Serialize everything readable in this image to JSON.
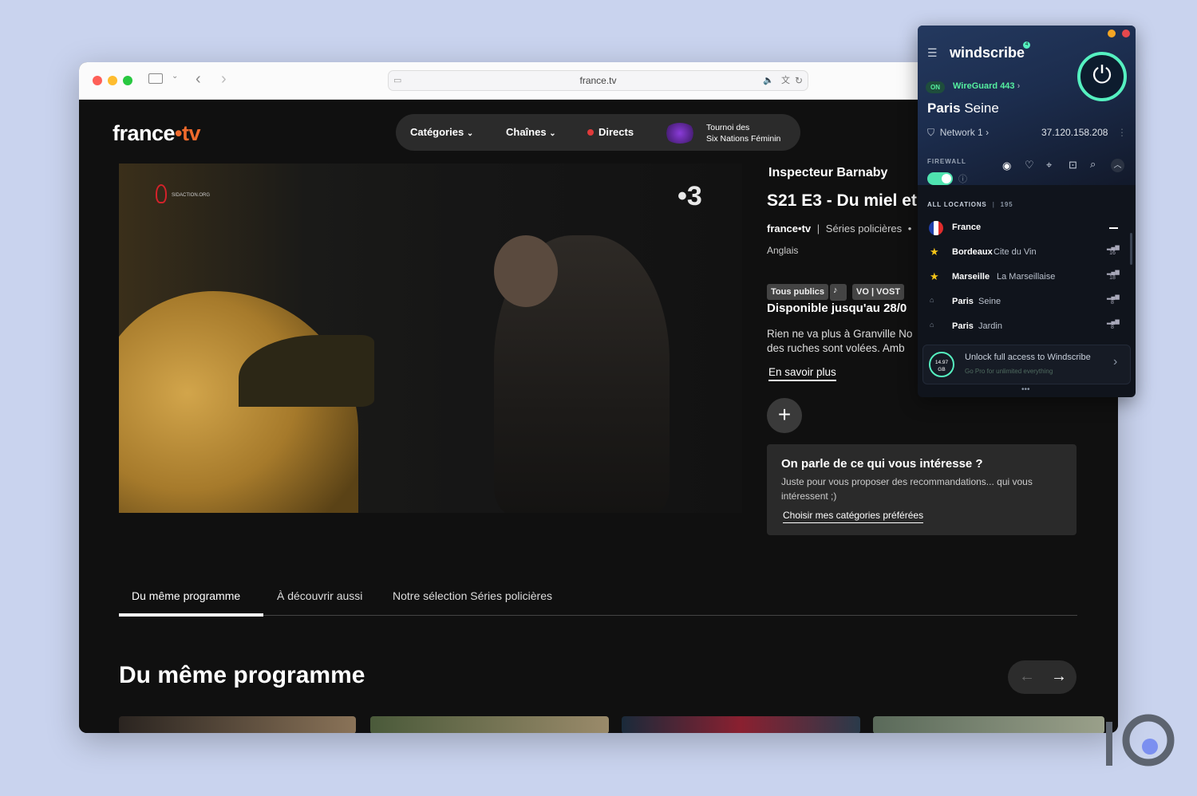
{
  "browser": {
    "url": "france.tv"
  },
  "site": {
    "logo_a": "france",
    "logo_dot": "•",
    "logo_b": "tv",
    "nav": {
      "categories": "Catégories",
      "channels": "Chaînes",
      "live": "Directs",
      "event_line1": "Tournoi des",
      "event_line2": "Six Nations Féminin"
    },
    "video": {
      "channel_badge": "•3",
      "sidaction": "SIDACTION.ORG"
    },
    "program": {
      "title": "Inspecteur Barnaby",
      "episode": "S21 E3 - Du miel et",
      "brand": "france•tv",
      "separator": "|",
      "genre": "Séries policières",
      "bullet": "•",
      "language": "Anglais",
      "tags": [
        "Tous publics",
        "VO | VOST"
      ],
      "availability": "Disponible jusqu'au 28/0",
      "synopsis_line1": "Rien ne va plus à Granville No",
      "synopsis_line2": "des ruches sont volées. Amb",
      "learn_more": "En savoir plus",
      "add_label": "+"
    },
    "reco": {
      "title": "On parle de ce qui vous intéresse ?",
      "text_line1": "Juste pour vous proposer des recommandations... qui vous",
      "text_line2": "intéressent ;)",
      "link": "Choisir mes catégories préférées"
    },
    "tabs": [
      "Du même programme",
      "À découvrir aussi",
      "Notre sélection Séries policières"
    ],
    "active_tab": 0,
    "section_title": "Du même programme"
  },
  "windscribe": {
    "brand": "windscribe",
    "notification_count": "4",
    "status": "ON",
    "protocol": "WireGuard 443",
    "location": "Paris",
    "location_sub": "Seine",
    "network": "Network 1",
    "ip": "37.120.158.208",
    "firewall_label": "FIREWALL",
    "firewall_on": true,
    "list_header": "ALL LOCATIONS",
    "location_count": "195",
    "country": "France",
    "locations": [
      {
        "city": "Bordeaux",
        "name": "Cite du Vin",
        "ping": "16",
        "favorite": true
      },
      {
        "city": "Marseille",
        "name": "La Marseillaise",
        "ping": "18",
        "favorite": true
      },
      {
        "city": "Paris",
        "name": "Seine",
        "ping": "8",
        "favorite": false
      },
      {
        "city": "Paris",
        "name": "Jardin",
        "ping": "8",
        "favorite": false
      }
    ],
    "data_left_value": "14.97",
    "data_left_unit": "GB",
    "unlock_title": "Unlock full access to Windscribe",
    "unlock_sub": "Go Pro for unlimited everything"
  },
  "colors": {
    "accent_orange": "#ef6a2c",
    "live_red": "#e03a3a",
    "ws_green": "#55f0c0",
    "star": "#f5c518"
  }
}
